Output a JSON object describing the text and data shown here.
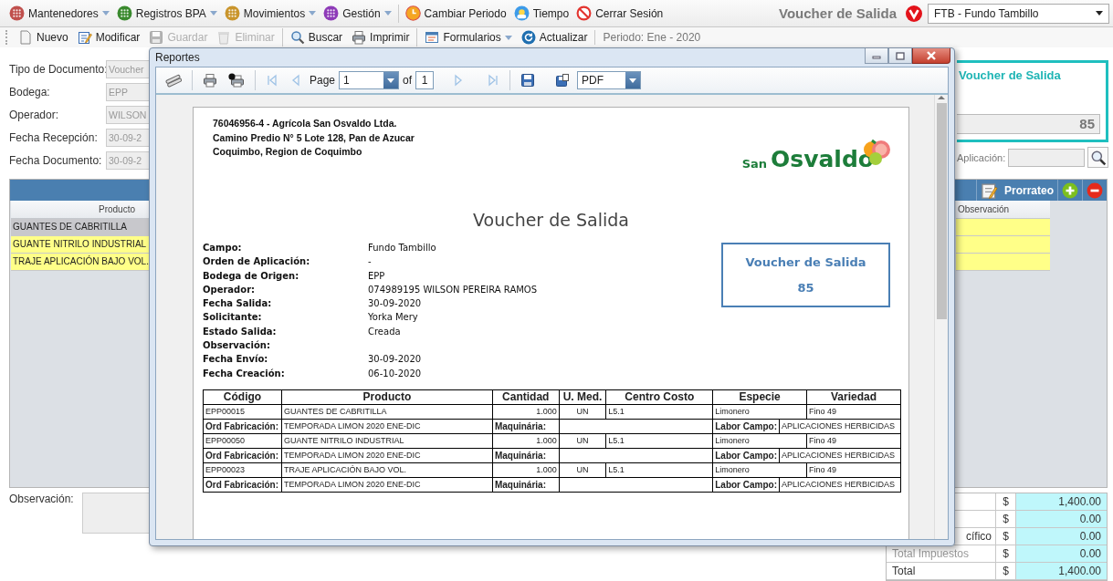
{
  "menu": {
    "items": [
      {
        "label": "Mantenedores",
        "color": "#c0504d",
        "has_dropdown": true
      },
      {
        "label": "Registros BPA",
        "color": "#3a8a2e",
        "has_dropdown": true
      },
      {
        "label": "Movimientos",
        "color": "#c9952c",
        "has_dropdown": true
      },
      {
        "label": "Gestión",
        "color": "#8e3bb8",
        "has_dropdown": true
      }
    ],
    "actions": [
      {
        "label": "Cambiar Periodo",
        "kind": "clock"
      },
      {
        "label": "Tiempo",
        "kind": "weather"
      },
      {
        "label": "Cerrar Sesión",
        "kind": "logout"
      }
    ],
    "screen_title": "Voucher de Salida",
    "farm_select": "FTB - Fundo Tambillo"
  },
  "toolbar": {
    "buttons": [
      {
        "label": "Nuevo",
        "kind": "new",
        "disabled": false,
        "separator_before": false,
        "has_dropdown": false
      },
      {
        "label": "Modificar",
        "kind": "edit",
        "disabled": false,
        "separator_before": false,
        "has_dropdown": false
      },
      {
        "label": "Guardar",
        "kind": "save",
        "disabled": true,
        "separator_before": false,
        "has_dropdown": false
      },
      {
        "label": "Eliminar",
        "kind": "delete",
        "disabled": true,
        "separator_before": false,
        "has_dropdown": false
      },
      {
        "label": "Buscar",
        "kind": "search",
        "disabled": false,
        "separator_before": true,
        "has_dropdown": false
      },
      {
        "label": "Imprimir",
        "kind": "print",
        "disabled": false,
        "separator_before": false,
        "has_dropdown": false
      },
      {
        "label": "Formularios",
        "kind": "forms",
        "disabled": false,
        "separator_before": true,
        "has_dropdown": true
      },
      {
        "label": "Actualizar",
        "kind": "refresh",
        "disabled": false,
        "separator_before": false,
        "has_dropdown": false
      }
    ],
    "period": "Periodo: Ene - 2020"
  },
  "form": {
    "fields": [
      {
        "label": "Tipo de Documento:",
        "value": "Voucher",
        "disabled": true
      },
      {
        "label": "Bodega:",
        "value": "EPP",
        "disabled": true
      },
      {
        "label": "Operador:",
        "value": "WILSON",
        "disabled": true
      },
      {
        "label": "Fecha Recepción:",
        "value": "30-09-2",
        "disabled": true
      },
      {
        "label": "Fecha Documento:",
        "value": "30-09-2",
        "disabled": true
      }
    ]
  },
  "voucher_card": {
    "title": "Voucher de Salida",
    "number": "85"
  },
  "aplicacion": {
    "label": "Aplicación:"
  },
  "grid": {
    "prorrateo": "Prorrateo",
    "columns": [
      "Producto",
      "Observación"
    ],
    "rows": [
      {
        "product": "GUANTES DE CABRITILLA",
        "selected": true
      },
      {
        "product": "GUANTE NITRILO INDUSTRIAL",
        "selected": false
      },
      {
        "product": "TRAJE APLICACIÓN BAJO VOL.",
        "selected": false
      }
    ]
  },
  "observacion": {
    "label": "Observación:"
  },
  "totals": [
    {
      "currency": "$",
      "value": "1,400.00"
    },
    {
      "currency": "$",
      "value": "0.00"
    },
    {
      "label": "cífico",
      "currency": "$",
      "value": "0.00"
    },
    {
      "label": "Total Impuestos",
      "currency": "$",
      "value": "0.00"
    },
    {
      "label": "Total",
      "currency": "$",
      "value": "1,400.00"
    }
  ],
  "report_window": {
    "title": "Reportes",
    "toolbar": {
      "page_label": "Page",
      "page": "1",
      "of_label": "of",
      "page_count": "1",
      "format": "PDF"
    },
    "document": {
      "company_lines": [
        "76046956-4 - Agrícola San Osvaldo Ltda.",
        "Camino Predio N° 5 Lote 128, Pan de Azucar",
        "Coquimbo, Region de Coquimbo"
      ],
      "logo": {
        "small": "San",
        "large": "Osvaldo"
      },
      "title": "Voucher de Salida",
      "fields": [
        {
          "label": "Campo:",
          "value": "Fundo Tambillo"
        },
        {
          "label": "Orden de Aplicación:",
          "value": "-"
        },
        {
          "label": "Bodega de Origen:",
          "value": "EPP"
        },
        {
          "label": "Operador:",
          "value": "074989195 WILSON PEREIRA RAMOS"
        },
        {
          "label": "Fecha Salida:",
          "value": "30-09-2020"
        },
        {
          "label": "Solicitante:",
          "value": "Yorka Mery"
        },
        {
          "label": "Estado Salida:",
          "value": "Creada"
        },
        {
          "label": "Observación:"
        },
        {
          "label": "Fecha Envío:",
          "value": "30-09-2020"
        },
        {
          "label": "Fecha Creación:",
          "value": "06-10-2020"
        }
      ],
      "voucher_box": {
        "title": "Voucher de Salida",
        "number": "85"
      },
      "table": {
        "columns": [
          "Código",
          "Producto",
          "Cantidad",
          "U. Med.",
          "Centro Costo",
          "Especie",
          "Variedad"
        ],
        "items": [
          {
            "code": "EPP00015",
            "product": "GUANTES DE CABRITILLA",
            "quantity": "1.000",
            "unit": "UN",
            "cost_center": "L5.1",
            "species": "Limonero",
            "variety": "Fino 49",
            "ord_label": "Ord Fabricación:",
            "ord_value": "TEMPORADA LIMON 2020 ENE-DIC",
            "machinery_label": "Maquinária:",
            "labor_label": "Labor Campo:",
            "labor_value": "APLICACIONES HERBICIDAS"
          },
          {
            "code": "EPP00050",
            "product": "GUANTE NITRILO INDUSTRIAL",
            "quantity": "1.000",
            "unit": "UN",
            "cost_center": "L5.1",
            "species": "Limonero",
            "variety": "Fino 49",
            "ord_label": "Ord Fabricación:",
            "ord_value": "TEMPORADA LIMON 2020 ENE-DIC",
            "machinery_label": "Maquinária:",
            "labor_label": "Labor Campo:",
            "labor_value": "APLICACIONES HERBICIDAS"
          },
          {
            "code": "EPP00023",
            "product": "TRAJE APLICACIÓN BAJO VOL.",
            "quantity": "1.000",
            "unit": "UN",
            "cost_center": "L5.1",
            "species": "Limonero",
            "variety": "Fino 49",
            "ord_label": "Ord Fabricación:",
            "ord_value": "TEMPORADA LIMON 2020 ENE-DIC",
            "machinery_label": "Maquinária:",
            "labor_label": "Labor Campo:",
            "labor_value": "APLICACIONES HERBICIDAS"
          }
        ]
      }
    }
  }
}
